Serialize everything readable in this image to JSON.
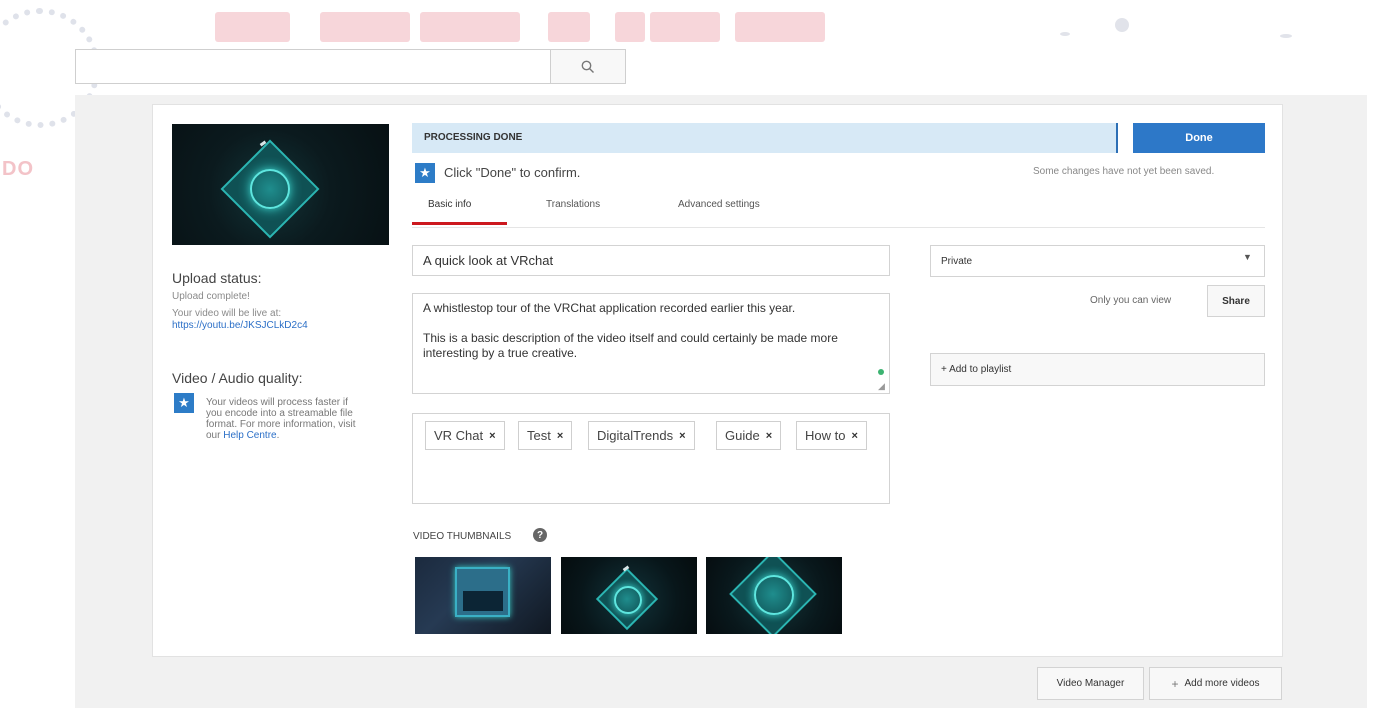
{
  "watermark": {
    "partial_text": "DO"
  },
  "search": {
    "icon": "search-icon"
  },
  "processing": {
    "status": "PROCESSING DONE",
    "done_label": "Done",
    "confirm_text": "Click \"Done\" to confirm.",
    "unsaved_text": "Some changes have not yet been saved."
  },
  "tabs": [
    {
      "label": "Basic info",
      "active": true
    },
    {
      "label": "Translations",
      "active": false
    },
    {
      "label": "Advanced settings",
      "active": false
    }
  ],
  "sidebar": {
    "upload_status_heading": "Upload status:",
    "upload_complete": "Upload complete!",
    "live_at": "Your video will be live at:",
    "url": "https://youtu.be/JKSJCLkD2c4",
    "quality_heading": "Video / Audio quality:",
    "quality_text": "Your videos will process faster if you encode into a streamable file format. For more information, visit our",
    "help_link": "Help Centre",
    "help_suffix": "."
  },
  "form": {
    "title": "A quick look at VRchat",
    "description": "A whistlestop tour of the VRChat application recorded earlier this year.\n\nThis is a basic description of the video itself and could certainly be made more interesting by a true creative.",
    "tags": [
      "VR Chat",
      "Test",
      "DigitalTrends",
      "Guide",
      "How to"
    ],
    "tag_remove_symbol": "×",
    "thumbnails_label": "VIDEO THUMBNAILS",
    "help_icon_symbol": "?"
  },
  "right": {
    "privacy": "Private",
    "only_you": "Only you can view",
    "share_label": "Share",
    "playlist_label": "+ Add to playlist"
  },
  "bottom": {
    "video_manager": "Video Manager",
    "add_more_plus": "+",
    "add_more": "Add more videos"
  },
  "colors": {
    "accent_blue": "#2d78c8",
    "tab_underline_red": "#cc181e",
    "processing_bg": "#d7e9f6"
  }
}
